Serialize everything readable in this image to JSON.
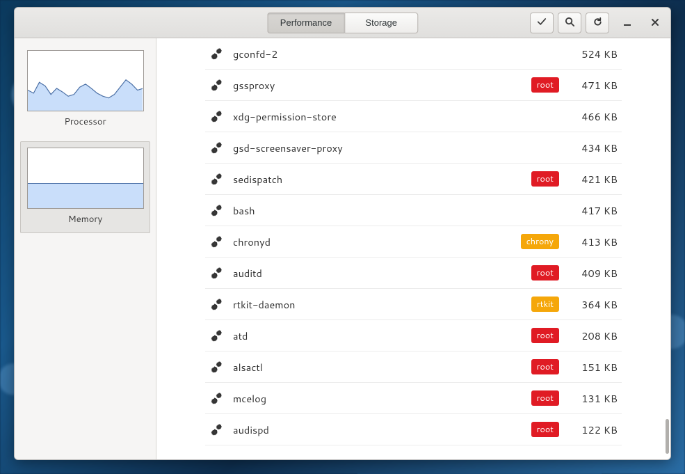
{
  "header": {
    "tabs": [
      {
        "label": "Performance",
        "active": true
      },
      {
        "label": "Storage",
        "active": false
      }
    ],
    "icons": {
      "check": "check-icon",
      "search": "search-icon",
      "refresh": "refresh-icon",
      "minimize": "minimize-icon",
      "close": "close-icon"
    }
  },
  "sidebar": {
    "items": [
      {
        "id": "processor",
        "label": "Processor",
        "selected": false
      },
      {
        "id": "memory",
        "label": "Memory",
        "selected": true
      }
    ]
  },
  "processes": [
    {
      "name": "gconfd-2",
      "tag": null,
      "tagColor": null,
      "size": "524 KB"
    },
    {
      "name": "gssproxy",
      "tag": "root",
      "tagColor": "root",
      "size": "471 KB"
    },
    {
      "name": "xdg-permission-store",
      "tag": null,
      "tagColor": null,
      "size": "466 KB"
    },
    {
      "name": "gsd-screensaver-proxy",
      "tag": null,
      "tagColor": null,
      "size": "434 KB"
    },
    {
      "name": "sedispatch",
      "tag": "root",
      "tagColor": "root",
      "size": "421 KB"
    },
    {
      "name": "bash",
      "tag": null,
      "tagColor": null,
      "size": "417 KB"
    },
    {
      "name": "chronyd",
      "tag": "chrony",
      "tagColor": "chrony",
      "size": "413 KB"
    },
    {
      "name": "auditd",
      "tag": "root",
      "tagColor": "root",
      "size": "409 KB"
    },
    {
      "name": "rtkit-daemon",
      "tag": "rtkit",
      "tagColor": "rtkit",
      "size": "364 KB"
    },
    {
      "name": "atd",
      "tag": "root",
      "tagColor": "root",
      "size": "208 KB"
    },
    {
      "name": "alsactl",
      "tag": "root",
      "tagColor": "root",
      "size": "151 KB"
    },
    {
      "name": "mcelog",
      "tag": "root",
      "tagColor": "root",
      "size": "131 KB"
    },
    {
      "name": "audispd",
      "tag": "root",
      "tagColor": "root",
      "size": "122 KB"
    }
  ],
  "chart_data": [
    {
      "type": "area",
      "id": "processor-thumb",
      "title": "Processor",
      "x": [
        0,
        1,
        2,
        3,
        4,
        5,
        6,
        7,
        8,
        9,
        10,
        11,
        12,
        13,
        14,
        15,
        16,
        17,
        18,
        19,
        20
      ],
      "values": [
        35,
        30,
        48,
        42,
        28,
        38,
        32,
        25,
        28,
        40,
        45,
        38,
        30,
        25,
        22,
        28,
        40,
        52,
        45,
        35,
        38
      ],
      "ylim": [
        0,
        100
      ],
      "fill": "#c9defa",
      "stroke": "#4a6fa5"
    },
    {
      "type": "area",
      "id": "memory-thumb",
      "title": "Memory",
      "x": [
        0,
        1
      ],
      "values": [
        42,
        42
      ],
      "ylim": [
        0,
        100
      ],
      "fill": "#c9defa",
      "stroke": "#4a6fa5"
    }
  ]
}
